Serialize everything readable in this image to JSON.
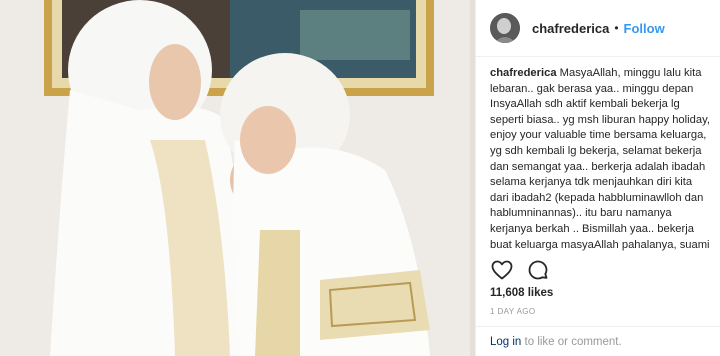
{
  "header": {
    "username": "chafrederica",
    "separator": "•",
    "follow_label": "Follow"
  },
  "caption": {
    "username": "chafrederica",
    "text": "MasyaAllah, minggu lalu kita lebaran.. gak berasa yaa.. minggu depan InsyaAllah sdh aktif kembali bekerja lg seperti biasa.. yg msh liburan happy holiday, enjoy your valuable time bersama keluarga, yg sdh kembali lg bekerja, selamat bekerja dan semangat yaa.. berkerja adalah ibadah selama kerjanya tdk menjauhkan diri kita dari ibadah2 (kepada habbluminawlloh dan hablumninannas).. itu baru namanya kerjanya berkah .. Bismillah yaa.. bekerja buat keluarga masyaAllah pahalanya, suami kasih uang k istri itu sedekah.. Allah yang ngitung berapa.."
  },
  "actions": {
    "like_icon": "heart-outline-icon",
    "comment_icon": "speech-bubble-icon"
  },
  "likes": "11,608 likes",
  "timestamp": "1 DAY AGO",
  "comment_bar": {
    "login_label": "Log in",
    "rest": " to like or comment."
  },
  "colors": {
    "follow": "#3897f0",
    "text": "#262626",
    "muted": "#999999",
    "border": "#efefef",
    "frame_gold": "#c9a24a"
  }
}
